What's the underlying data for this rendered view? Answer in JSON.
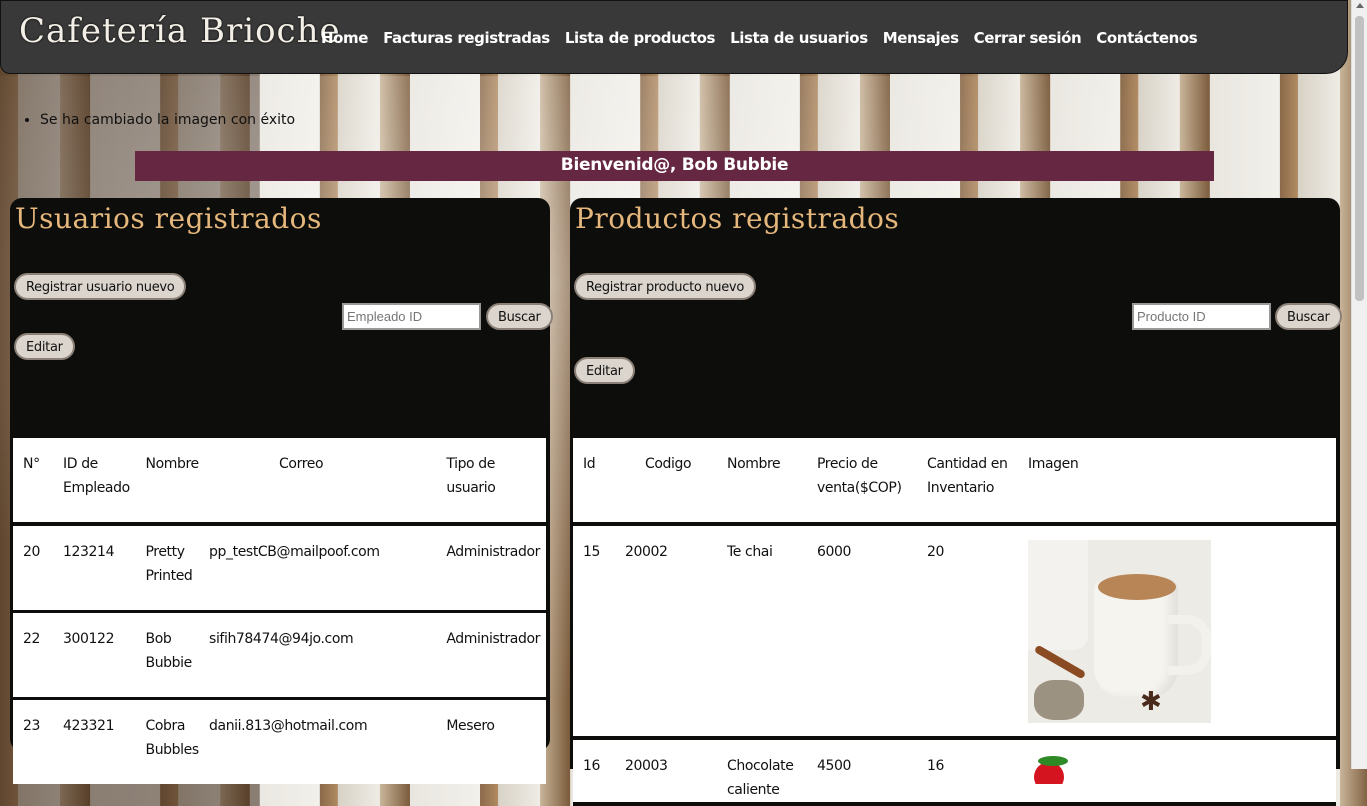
{
  "brand": "Cafetería Brioche",
  "nav": [
    "Home",
    "Facturas registradas",
    "Lista de productos",
    "Lista de usuarios",
    "Mensajes",
    "Cerrar sesión",
    "Contáctenos"
  ],
  "flash_message": "Se ha cambiado la imagen con éxito",
  "welcome": "Bienvenid@, Bob Bubbie",
  "users": {
    "title": "Usuarios registrados",
    "register_button": "Registrar usuario nuevo",
    "search_placeholder": "Empleado ID",
    "search_button": "Buscar",
    "edit_button": "Editar",
    "columns": [
      "N°",
      "ID de Empleado",
      "Nombre",
      "Correo",
      "Tipo de usuario"
    ],
    "rows": [
      {
        "n": "20",
        "id": "123214",
        "name": "Pretty Printed",
        "email": "pp_testCB@mailpoof.com",
        "type": "Administrador"
      },
      {
        "n": "22",
        "id": "300122",
        "name": "Bob Bubbie",
        "email": "sifih78474@94jo.com",
        "type": "Administrador"
      },
      {
        "n": "23",
        "id": "423321",
        "name": "Cobra Bubbles",
        "email": "danii.813@hotmail.com",
        "type": "Mesero"
      }
    ]
  },
  "products": {
    "title": "Productos registrados",
    "register_button": "Registrar producto nuevo",
    "search_placeholder": "Producto ID",
    "search_button": "Buscar",
    "edit_button": "Editar",
    "columns": [
      "Id",
      "Codigo",
      "Nombre",
      "Precio de venta($COP)",
      "Cantidad en Inventario",
      "Imagen"
    ],
    "rows": [
      {
        "id": "15",
        "code": "20002",
        "name": "Te chai",
        "price": "6000",
        "qty": "20",
        "image": "chai-latte-image"
      },
      {
        "id": "16",
        "code": "20003",
        "name": "Chocolate caliente",
        "price": "4500",
        "qty": "16",
        "image": "strawberry-image"
      }
    ]
  }
}
